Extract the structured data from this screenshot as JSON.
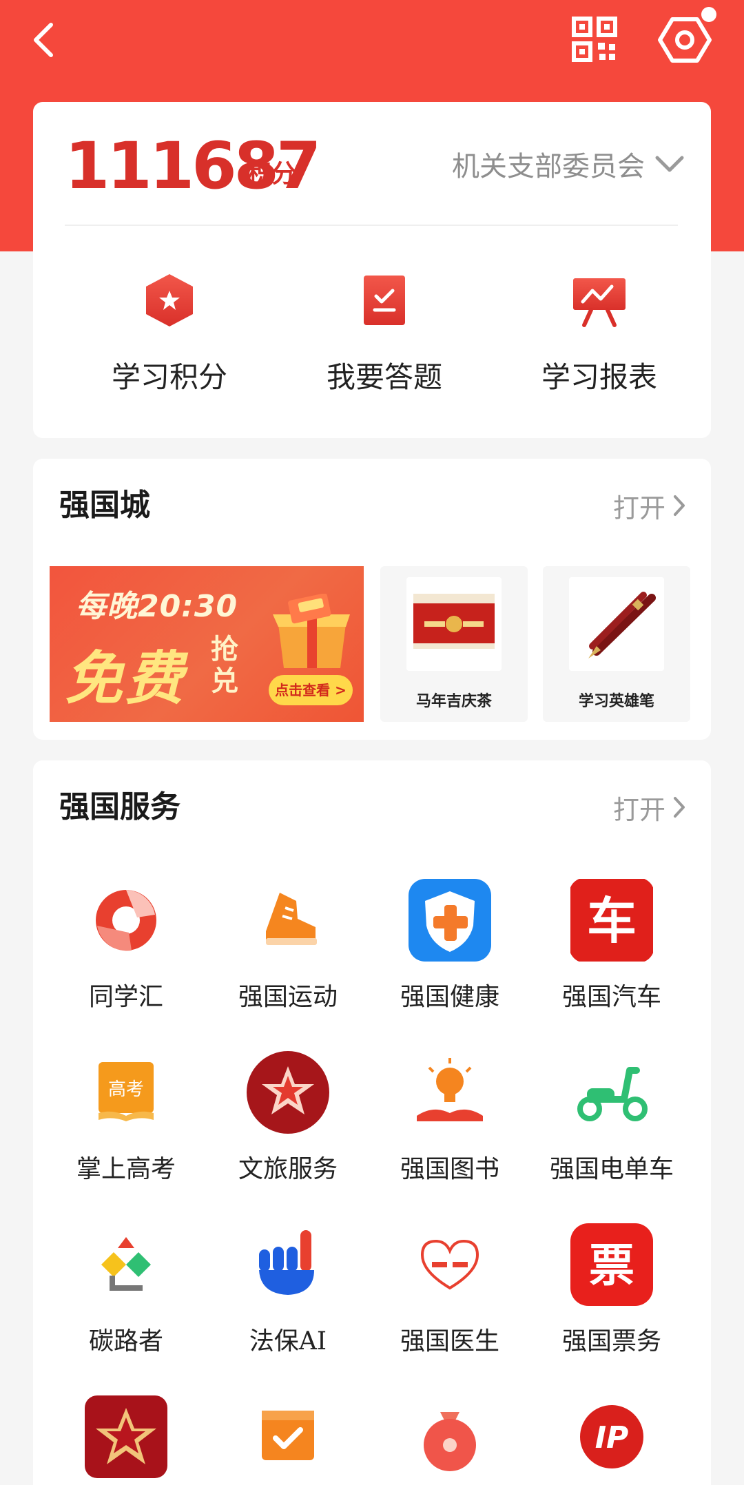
{
  "points": {
    "value": "111687",
    "unit": "积分"
  },
  "org": {
    "name": "机关支部委员会"
  },
  "quick_actions": [
    {
      "label": "学习积分",
      "icon": "star-badge-icon"
    },
    {
      "label": "我要答题",
      "icon": "checklist-icon"
    },
    {
      "label": "学习报表",
      "icon": "report-board-icon"
    }
  ],
  "mall": {
    "title": "强国城",
    "open_label": "打开",
    "banner": {
      "line1": "每晚20:30",
      "line2": "免费",
      "line3": "抢兑",
      "button": "点击查看 >"
    },
    "products": [
      {
        "name": "马年吉庆茶"
      },
      {
        "name": "学习英雄笔"
      }
    ]
  },
  "services": {
    "title": "强国服务",
    "open_label": "打开",
    "items": [
      {
        "label": "同学汇",
        "icon": "tongxuehui-icon"
      },
      {
        "label": "强国运动",
        "icon": "sneaker-icon"
      },
      {
        "label": "强国健康",
        "icon": "health-shield-icon"
      },
      {
        "label": "强国汽车",
        "icon": "car-char-icon",
        "glyph": "车"
      },
      {
        "label": "掌上高考",
        "icon": "gaokao-book-icon",
        "glyph": "高考"
      },
      {
        "label": "文旅服务",
        "icon": "star-flower-icon"
      },
      {
        "label": "强国图书",
        "icon": "lightbulb-book-icon"
      },
      {
        "label": "强国电单车",
        "icon": "scooter-icon"
      },
      {
        "label": "碳路者",
        "icon": "carbon-shapes-icon"
      },
      {
        "label": "法保AI",
        "icon": "raised-hand-icon"
      },
      {
        "label": "强国医生",
        "icon": "heart-doctor-icon"
      },
      {
        "label": "强国票务",
        "icon": "ticket-char-icon",
        "glyph": "票"
      },
      {
        "label": "",
        "icon": "star-a-icon"
      },
      {
        "label": "",
        "icon": "calendar-check-icon"
      },
      {
        "label": "",
        "icon": "money-bag-icon"
      },
      {
        "label": "",
        "icon": "ip-circle-icon",
        "glyph": "IP"
      }
    ]
  },
  "colors": {
    "brand_red": "#f5483c",
    "points_red": "#d8302a"
  }
}
